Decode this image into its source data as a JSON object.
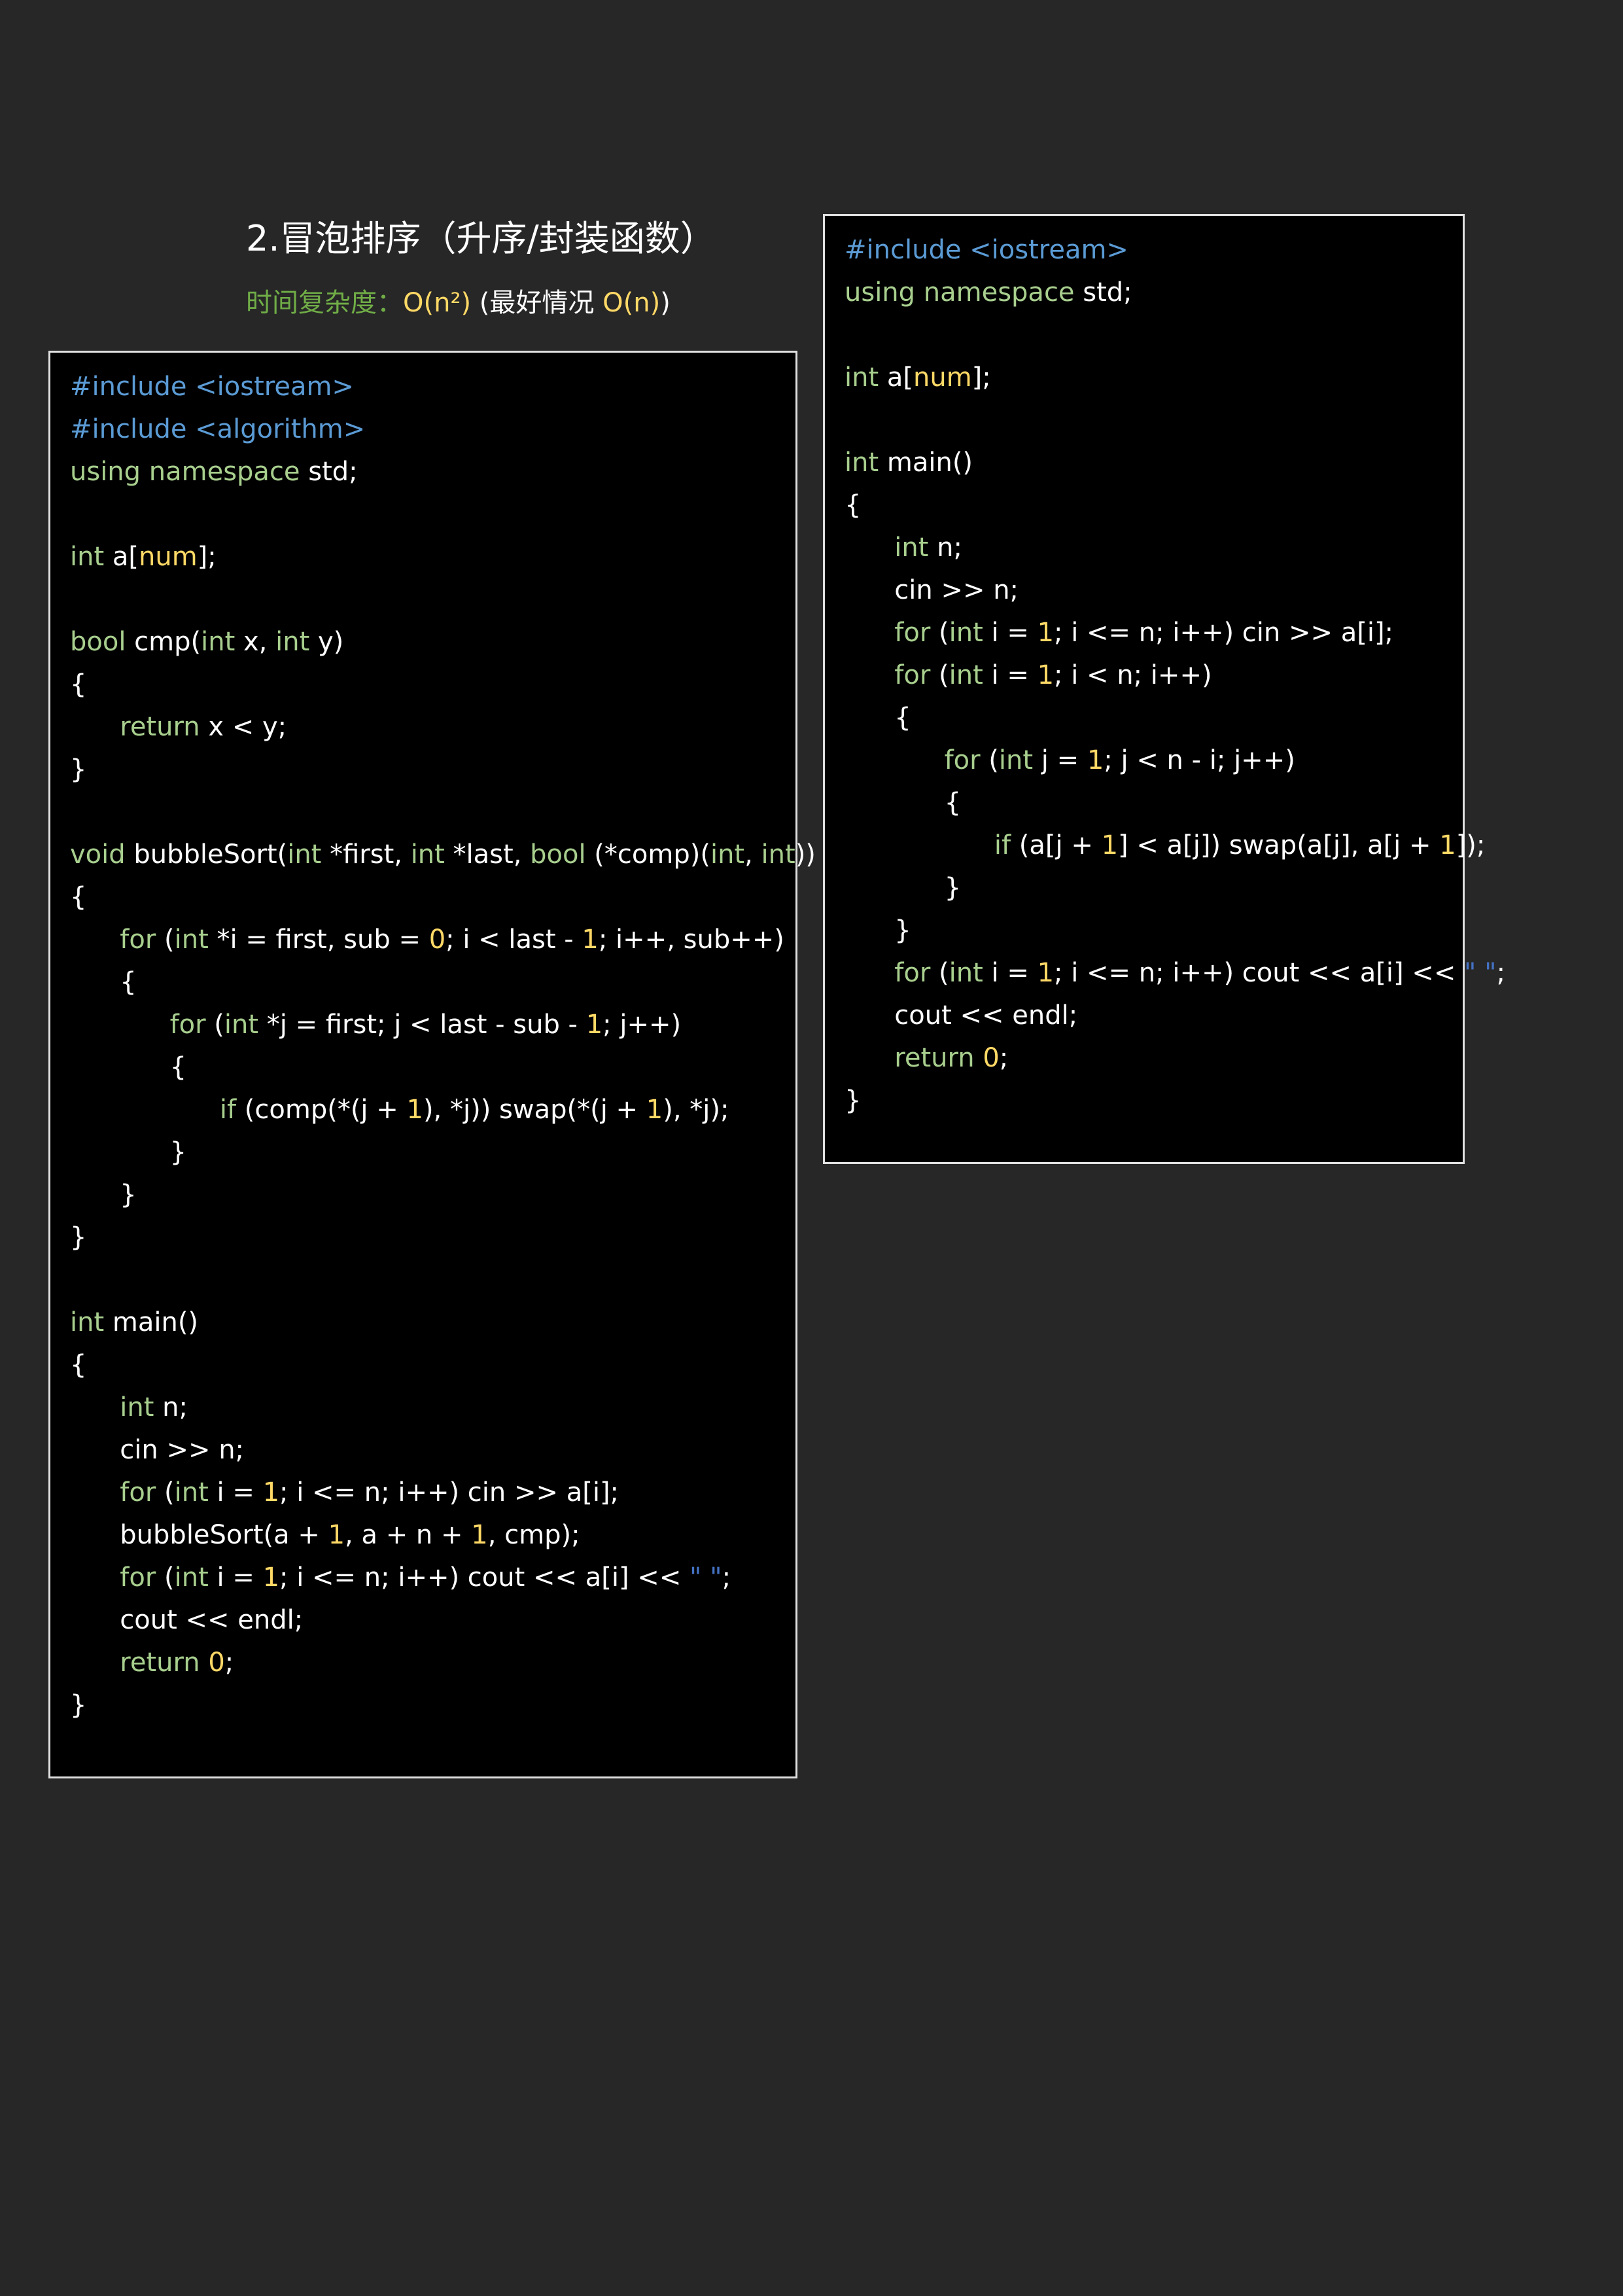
{
  "title": "2.冒泡排序（升序/封装函数）",
  "complexity": {
    "label": "时间复杂度：",
    "value": "O(n²)",
    "best_open": " (最好情况 ",
    "best_value": "O(n)",
    "close": ")"
  },
  "code_left": [
    [
      [
        "pp",
        "#include <iostream>"
      ]
    ],
    [
      [
        "pp",
        "#include <algorithm>"
      ]
    ],
    [
      [
        "kw",
        "using namespace"
      ],
      [
        "",
        " std;"
      ]
    ],
    [],
    [
      [
        "kw",
        "int"
      ],
      [
        "",
        " a["
      ],
      [
        "num",
        "num"
      ],
      [
        "",
        "];"
      ]
    ],
    [],
    [
      [
        "kw",
        "bool"
      ],
      [
        "",
        " cmp("
      ],
      [
        "kw",
        "int"
      ],
      [
        "",
        " x, "
      ],
      [
        "kw",
        "int"
      ],
      [
        "",
        " y)"
      ]
    ],
    [
      [
        "",
        "{"
      ]
    ],
    [
      [
        "",
        "      "
      ],
      [
        "kw",
        "return"
      ],
      [
        "",
        " x < y;"
      ]
    ],
    [
      [
        "",
        "}"
      ]
    ],
    [],
    [
      [
        "kw",
        "void"
      ],
      [
        "",
        " bubbleSort("
      ],
      [
        "kw",
        "int"
      ],
      [
        "",
        " *first, "
      ],
      [
        "kw",
        "int"
      ],
      [
        "",
        " *last, "
      ],
      [
        "kw",
        "bool"
      ],
      [
        "",
        " (*comp)("
      ],
      [
        "kw",
        "int"
      ],
      [
        "",
        ", "
      ],
      [
        "kw",
        "int"
      ],
      [
        "",
        "))"
      ]
    ],
    [
      [
        "",
        "{"
      ]
    ],
    [
      [
        "",
        "      "
      ],
      [
        "kw",
        "for"
      ],
      [
        "",
        " ("
      ],
      [
        "kw",
        "int"
      ],
      [
        "",
        " *i = first, sub = "
      ],
      [
        "num",
        "0"
      ],
      [
        "",
        "; i < last - "
      ],
      [
        "num",
        "1"
      ],
      [
        "",
        "; i++, sub++)"
      ]
    ],
    [
      [
        "",
        "      {"
      ]
    ],
    [
      [
        "",
        "            "
      ],
      [
        "kw",
        "for"
      ],
      [
        "",
        " ("
      ],
      [
        "kw",
        "int"
      ],
      [
        "",
        " *j = first; j < last - sub - "
      ],
      [
        "num",
        "1"
      ],
      [
        "",
        "; j++)"
      ]
    ],
    [
      [
        "",
        "            {"
      ]
    ],
    [
      [
        "",
        "                  "
      ],
      [
        "kw",
        "if"
      ],
      [
        "",
        " (comp(*(j + "
      ],
      [
        "num",
        "1"
      ],
      [
        "",
        "), *j)) swap(*(j + "
      ],
      [
        "num",
        "1"
      ],
      [
        "",
        "), *j);"
      ]
    ],
    [
      [
        "",
        "            }"
      ]
    ],
    [
      [
        "",
        "      }"
      ]
    ],
    [
      [
        "",
        "}"
      ]
    ],
    [],
    [
      [
        "kw",
        "int"
      ],
      [
        "",
        " main()"
      ]
    ],
    [
      [
        "",
        "{"
      ]
    ],
    [
      [
        "",
        "      "
      ],
      [
        "kw",
        "int"
      ],
      [
        "",
        " n;"
      ]
    ],
    [
      [
        "",
        "      cin >> n;"
      ]
    ],
    [
      [
        "",
        "      "
      ],
      [
        "kw",
        "for"
      ],
      [
        "",
        " ("
      ],
      [
        "kw",
        "int"
      ],
      [
        "",
        " i = "
      ],
      [
        "num",
        "1"
      ],
      [
        "",
        "; i <= n; i++) cin >> a[i];"
      ]
    ],
    [
      [
        "",
        "      bubbleSort(a + "
      ],
      [
        "num",
        "1"
      ],
      [
        "",
        ", a + n + "
      ],
      [
        "num",
        "1"
      ],
      [
        "",
        ", cmp);"
      ]
    ],
    [
      [
        "",
        "      "
      ],
      [
        "kw",
        "for"
      ],
      [
        "",
        " ("
      ],
      [
        "kw",
        "int"
      ],
      [
        "",
        " i = "
      ],
      [
        "num",
        "1"
      ],
      [
        "",
        "; i <= n; i++) cout << a[i] << "
      ],
      [
        "str",
        "\" \""
      ],
      [
        "",
        ";"
      ]
    ],
    [
      [
        "",
        "      cout << endl;"
      ]
    ],
    [
      [
        "",
        "      "
      ],
      [
        "kw",
        "return"
      ],
      [
        "",
        " "
      ],
      [
        "num",
        "0"
      ],
      [
        "",
        ";"
      ]
    ],
    [
      [
        "",
        "}"
      ]
    ]
  ],
  "code_right": [
    [
      [
        "pp",
        "#include <iostream>"
      ]
    ],
    [
      [
        "kw",
        "using namespace"
      ],
      [
        "",
        " std;"
      ]
    ],
    [],
    [
      [
        "kw",
        "int"
      ],
      [
        "",
        " a["
      ],
      [
        "num",
        "num"
      ],
      [
        "",
        "];"
      ]
    ],
    [],
    [
      [
        "kw",
        "int"
      ],
      [
        "",
        " main()"
      ]
    ],
    [
      [
        "",
        "{"
      ]
    ],
    [
      [
        "",
        "      "
      ],
      [
        "kw",
        "int"
      ],
      [
        "",
        " n;"
      ]
    ],
    [
      [
        "",
        "      cin >> n;"
      ]
    ],
    [
      [
        "",
        "      "
      ],
      [
        "kw",
        "for"
      ],
      [
        "",
        " ("
      ],
      [
        "kw",
        "int"
      ],
      [
        "",
        " i = "
      ],
      [
        "num",
        "1"
      ],
      [
        "",
        "; i <= n; i++) cin >> a[i];"
      ]
    ],
    [
      [
        "",
        "      "
      ],
      [
        "kw",
        "for"
      ],
      [
        "",
        " ("
      ],
      [
        "kw",
        "int"
      ],
      [
        "",
        " i = "
      ],
      [
        "num",
        "1"
      ],
      [
        "",
        "; i < n; i++)"
      ]
    ],
    [
      [
        "",
        "      {"
      ]
    ],
    [
      [
        "",
        "            "
      ],
      [
        "kw",
        "for"
      ],
      [
        "",
        " ("
      ],
      [
        "kw",
        "int"
      ],
      [
        "",
        " j = "
      ],
      [
        "num",
        "1"
      ],
      [
        "",
        "; j < n - i; j++)"
      ]
    ],
    [
      [
        "",
        "            {"
      ]
    ],
    [
      [
        "",
        "                  "
      ],
      [
        "kw",
        "if"
      ],
      [
        "",
        " (a[j + "
      ],
      [
        "num",
        "1"
      ],
      [
        "",
        "] < a[j]) swap(a[j], a[j + "
      ],
      [
        "num",
        "1"
      ],
      [
        "",
        "]);"
      ]
    ],
    [
      [
        "",
        "            }"
      ]
    ],
    [
      [
        "",
        "      }"
      ]
    ],
    [
      [
        "",
        "      "
      ],
      [
        "kw",
        "for"
      ],
      [
        "",
        " ("
      ],
      [
        "kw",
        "int"
      ],
      [
        "",
        " i = "
      ],
      [
        "num",
        "1"
      ],
      [
        "",
        "; i <= n; i++) cout << a[i] << "
      ],
      [
        "str",
        "\" \""
      ],
      [
        "",
        ";"
      ]
    ],
    [
      [
        "",
        "      cout << endl;"
      ]
    ],
    [
      [
        "",
        "      "
      ],
      [
        "kw",
        "return"
      ],
      [
        "",
        " "
      ],
      [
        "num",
        "0"
      ],
      [
        "",
        ";"
      ]
    ],
    [
      [
        "",
        "}"
      ]
    ]
  ]
}
